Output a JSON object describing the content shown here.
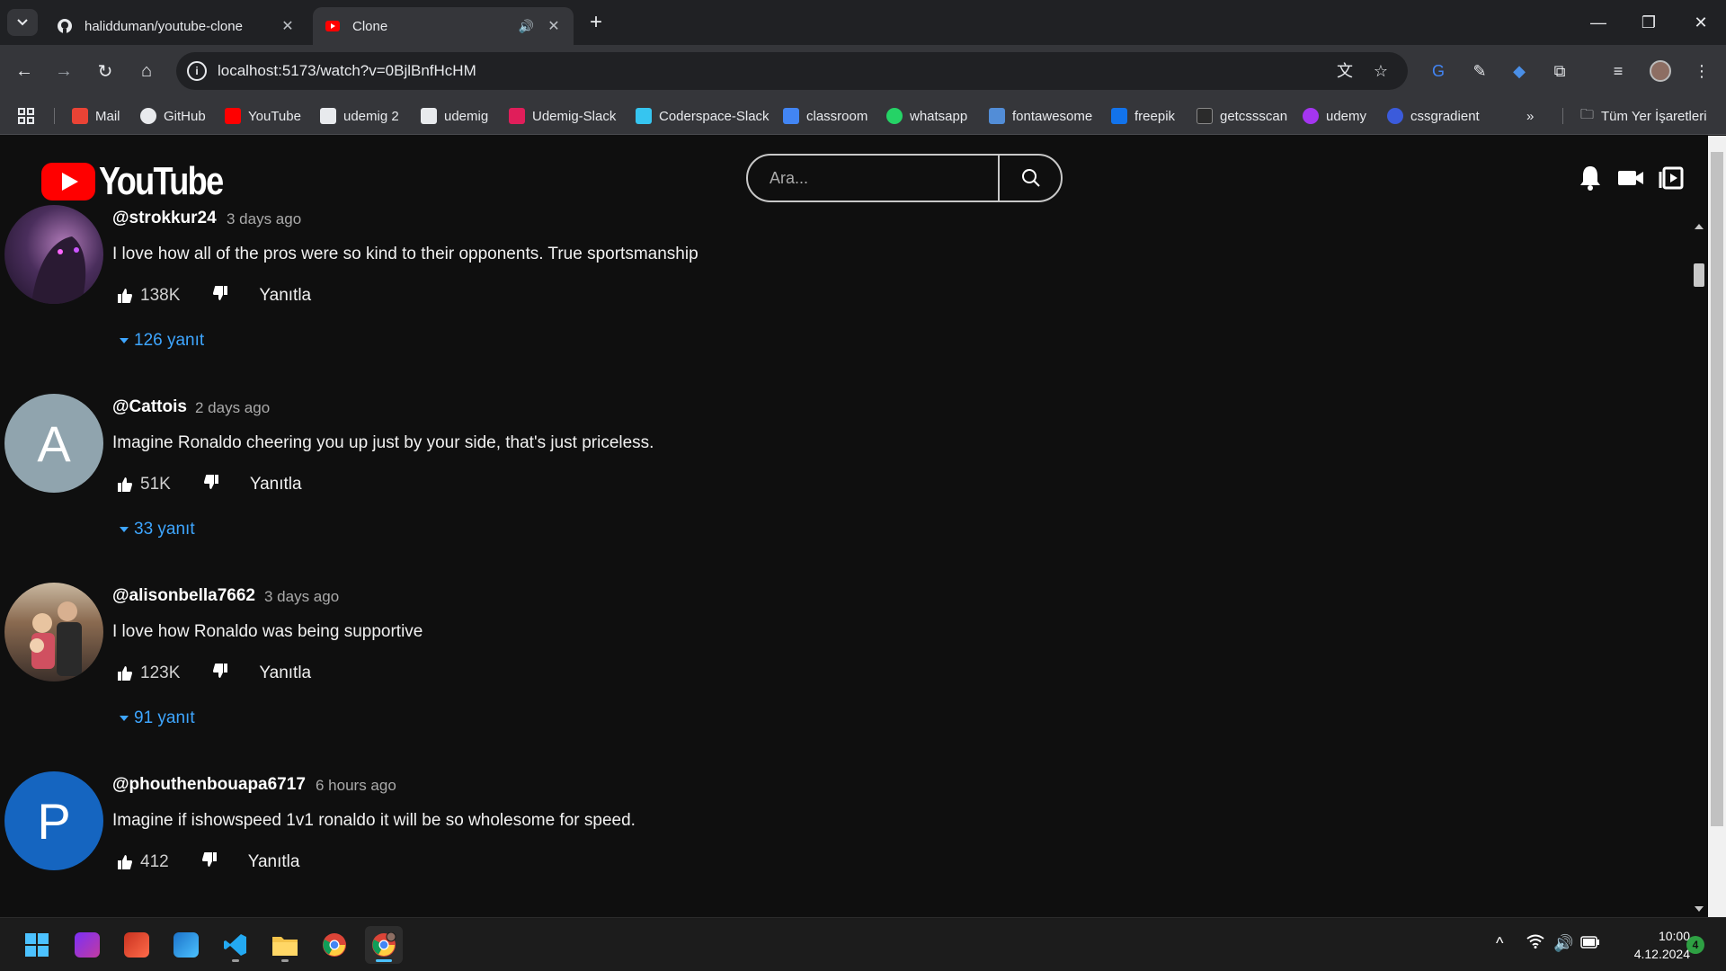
{
  "browser": {
    "tabs": [
      {
        "title": "halidduman/youtube-clone"
      },
      {
        "title": "Clone"
      }
    ],
    "url": "localhost:5173/watch?v=0BjlBnfHcHM",
    "bookmarks": [
      {
        "label": "Mail",
        "color": "#ea4335"
      },
      {
        "label": "GitHub",
        "color": "#ffffff"
      },
      {
        "label": "YouTube",
        "color": "#ff0000"
      },
      {
        "label": "udemig 2",
        "color": "#e8eaed"
      },
      {
        "label": "udemig",
        "color": "#e8eaed"
      },
      {
        "label": "Udemig-Slack",
        "color": "#e01e5a"
      },
      {
        "label": "Coderspace-Slack",
        "color": "#36c5f0"
      },
      {
        "label": "classroom",
        "color": "#4285f4"
      },
      {
        "label": "whatsapp",
        "color": "#25d366"
      },
      {
        "label": "fontawesome",
        "color": "#528dd7"
      },
      {
        "label": "freepik",
        "color": "#1273eb"
      },
      {
        "label": "getcssscan",
        "color": "#2b2b2b"
      },
      {
        "label": "udemy",
        "color": "#a435f0"
      },
      {
        "label": "cssgradient",
        "color": "#3b5bdb"
      }
    ],
    "all_bookmarks_label": "Tüm Yer İşaretleri"
  },
  "youtube": {
    "logo_text": "YouTube",
    "search_placeholder": "Ara...",
    "reply_label": "Yanıtla",
    "comments": [
      {
        "author": "@strokkur24",
        "time": "3 days ago",
        "text": "I love how all of the pros were so kind to their opponents. True sportsmanship",
        "likes": "138K",
        "replies": "126 yanıt",
        "avatar_letter": "",
        "avatar_color": "#3a2a4a"
      },
      {
        "author": "@Cattois",
        "time": "2 days ago",
        "text": "Imagine Ronaldo cheering you up just by your side, that's just priceless.",
        "likes": "51K",
        "replies": "33 yanıt",
        "avatar_letter": "A",
        "avatar_color": "#90a4ae"
      },
      {
        "author": "@alisonbella7662",
        "time": "3 days ago",
        "text": "I love how Ronaldo was being supportive",
        "likes": "123K",
        "replies": "91 yanıt",
        "avatar_letter": "",
        "avatar_color": "#5a4a3a"
      },
      {
        "author": "@phouthenbouapa6717",
        "time": "6 hours ago",
        "text": "Imagine if ishowspeed 1v1 ronaldo it will be so wholesome for speed.",
        "likes": "412",
        "replies": "",
        "avatar_letter": "P",
        "avatar_color": "#1565c0"
      }
    ]
  },
  "taskbar": {
    "time": "10:00",
    "date": "4.12.2024",
    "notifications": "4"
  }
}
